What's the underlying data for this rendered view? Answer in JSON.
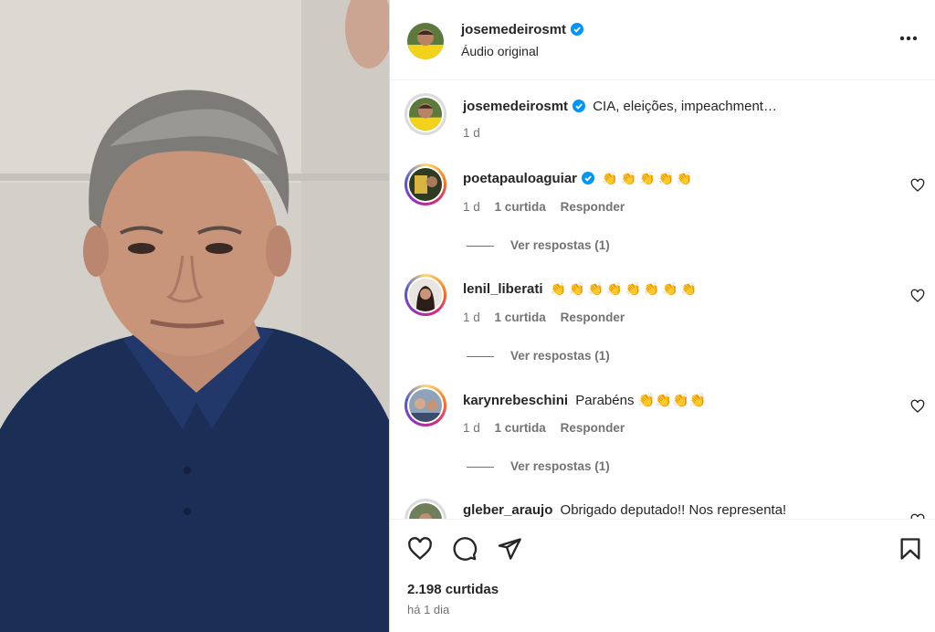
{
  "post": {
    "author": "josemedeirosmt",
    "audio_label": "Áudio original",
    "likes_text": "2.198 curtidas",
    "time_text": "há 1 dia"
  },
  "caption": {
    "user": "josemedeirosmt",
    "text": "CIA, eleições, impeachment…",
    "time": "1 d"
  },
  "comments": [
    {
      "user": "poetapauloaguiar",
      "verified": true,
      "text": "👏👏👏👏👏",
      "time": "1 d",
      "likes": "1 curtida",
      "reply_label": "Responder",
      "view_replies": "Ver respostas (1)"
    },
    {
      "user": "lenil_liberati",
      "verified": false,
      "text": "👏👏👏👏👏👏👏👏",
      "time": "1 d",
      "likes": "1 curtida",
      "reply_label": "Responder",
      "view_replies": "Ver respostas (1)"
    },
    {
      "user": "karynrebeschini",
      "verified": false,
      "text": "Parabéns 👏👏👏👏",
      "time": "1 d",
      "likes": "1 curtida",
      "reply_label": "Responder",
      "view_replies": "Ver respostas (1)"
    },
    {
      "user": "gleber_araujo",
      "verified": false,
      "text": "Obrigado deputado!! Nos representa!"
    }
  ],
  "icons": {
    "verified": "verified-badge-icon",
    "more": "more-options-icon",
    "like": "heart-icon",
    "comment": "comment-icon",
    "share": "send-icon",
    "save": "bookmark-icon"
  },
  "colors": {
    "verified": "#0095f6",
    "text": "#262626",
    "secondary": "#737373"
  }
}
